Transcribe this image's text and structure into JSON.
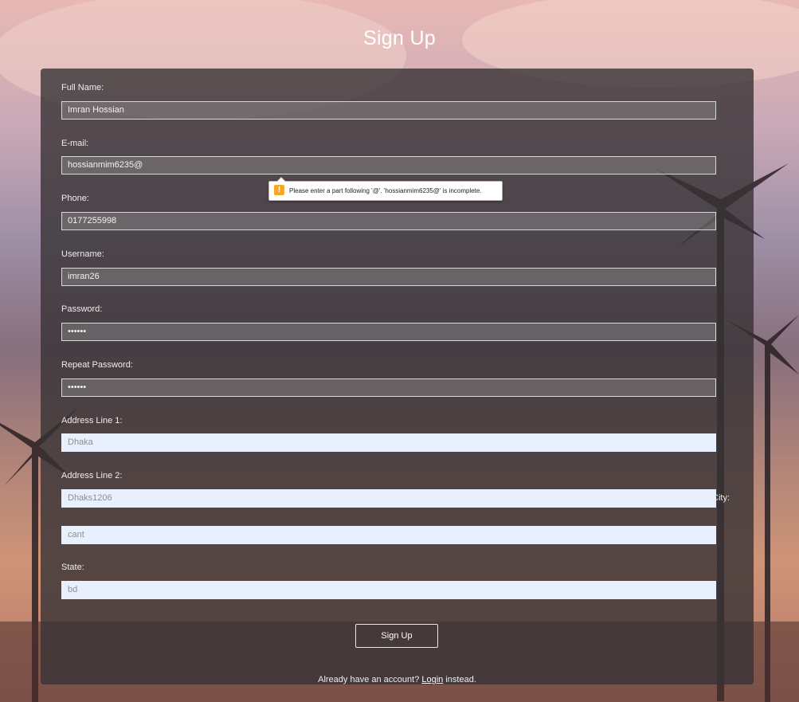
{
  "page": {
    "title": "Sign Up"
  },
  "form": {
    "full_name": {
      "label": "Full Name:",
      "value": "Imran Hossian"
    },
    "email": {
      "label": "E-mail:",
      "value": "hossianmim6235@"
    },
    "phone": {
      "label": "Phone:",
      "value": "0177255998"
    },
    "username": {
      "label": "Username:",
      "value": "imran26"
    },
    "password": {
      "label": "Password:",
      "value": "••••••"
    },
    "repeat_password": {
      "label": "Repeat Password:",
      "value": "••••••"
    },
    "address1": {
      "label": "Address Line 1:",
      "value": "Dhaka"
    },
    "address2": {
      "label": "Address Line 2:",
      "value": "Dhaks1206"
    },
    "city": {
      "label": "City:",
      "value": "cant"
    },
    "state": {
      "label": "State:",
      "value": "bd"
    },
    "submit_label": "Sign Up"
  },
  "validation": {
    "message": "Please enter a part following '@'. 'hossianmim6235@' is incomplete.",
    "icon_glyph": "!"
  },
  "footer": {
    "prefix": "Already have an account?",
    "login_label": "Login",
    "suffix": "instead."
  },
  "colors": {
    "panel_bg": "rgba(55,50,52,0.80)",
    "autofill_bg": "#e8f0fe",
    "warning": "#f7a823"
  }
}
